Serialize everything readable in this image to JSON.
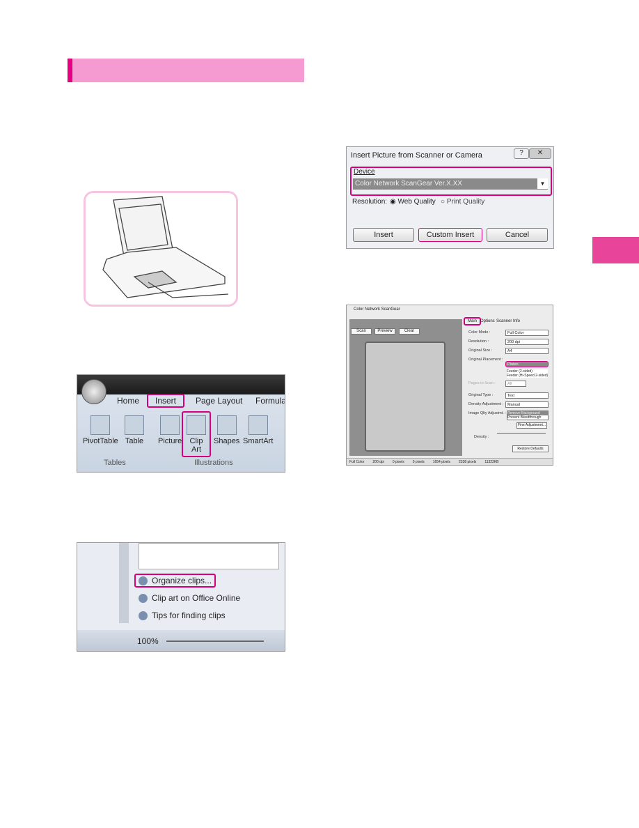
{
  "colors": {
    "header_bar": "#f59bd2",
    "accent": "#e4007f",
    "side_tab": "#e8449a",
    "highlight": "#d6007f"
  },
  "ribbon": {
    "tabs": [
      "Home",
      "Insert",
      "Page Layout",
      "Formulas"
    ],
    "buttons": [
      "PivotTable",
      "Table",
      "Picture",
      "Clip\nArt",
      "Shapes",
      "SmartArt"
    ],
    "groups": [
      "Tables",
      "Illustrations"
    ],
    "highlighted": [
      "Insert",
      "Clip Art"
    ]
  },
  "clip_pane": {
    "items": [
      "Organize clips...",
      "Clip art on Office Online",
      "Tips for finding clips"
    ],
    "zoom": "100%"
  },
  "insert_dialog": {
    "title": "Insert Picture from Scanner or Camera",
    "device_label": "Device",
    "device_value": "Color Network ScanGear Ver.X.XX",
    "resolution_label": "Resolution:",
    "web_quality": "Web Quality",
    "print_quality": "Print Quality",
    "selected_resolution": "Web Quality",
    "insert": "Insert",
    "custom_insert": "Custom Insert",
    "cancel": "Cancel"
  },
  "scangear": {
    "title": "Color Network ScanGear",
    "buttons": [
      "Scan",
      "Preview",
      "Clear"
    ],
    "tabs": [
      "Main",
      "Options",
      "Scanner Info"
    ],
    "fields": [
      {
        "label": "Color Mode :",
        "value": "Full Color"
      },
      {
        "label": "Resolution :",
        "value": "200 dpi"
      },
      {
        "label": "Original Size :",
        "value": "A4"
      },
      {
        "label": "Original Placement :",
        "value": ""
      }
    ],
    "placement_options": [
      "Platen",
      "Feeder (2-sided)",
      "Feeder (Hi-Speed 2-sided)"
    ],
    "pages_label": "Pages to Scan :",
    "pages_value": "All",
    "fields2": [
      {
        "label": "Original Type :",
        "value": "Text"
      },
      {
        "label": "Density Adjustment :",
        "value": "Manual"
      }
    ],
    "quality_label": "Image Qlty Adjustmt. :",
    "quality_options": [
      "Remove Background",
      "Prevent Bleedthrough"
    ],
    "fine": "Fine Adjustment...",
    "density": "Density :",
    "restore": "Restore Defaults",
    "status": [
      "Full Color",
      "200 dpi",
      "0 pixels",
      "0 pixels",
      "1654 pixels",
      "2338 pixels",
      "11322KB"
    ]
  }
}
